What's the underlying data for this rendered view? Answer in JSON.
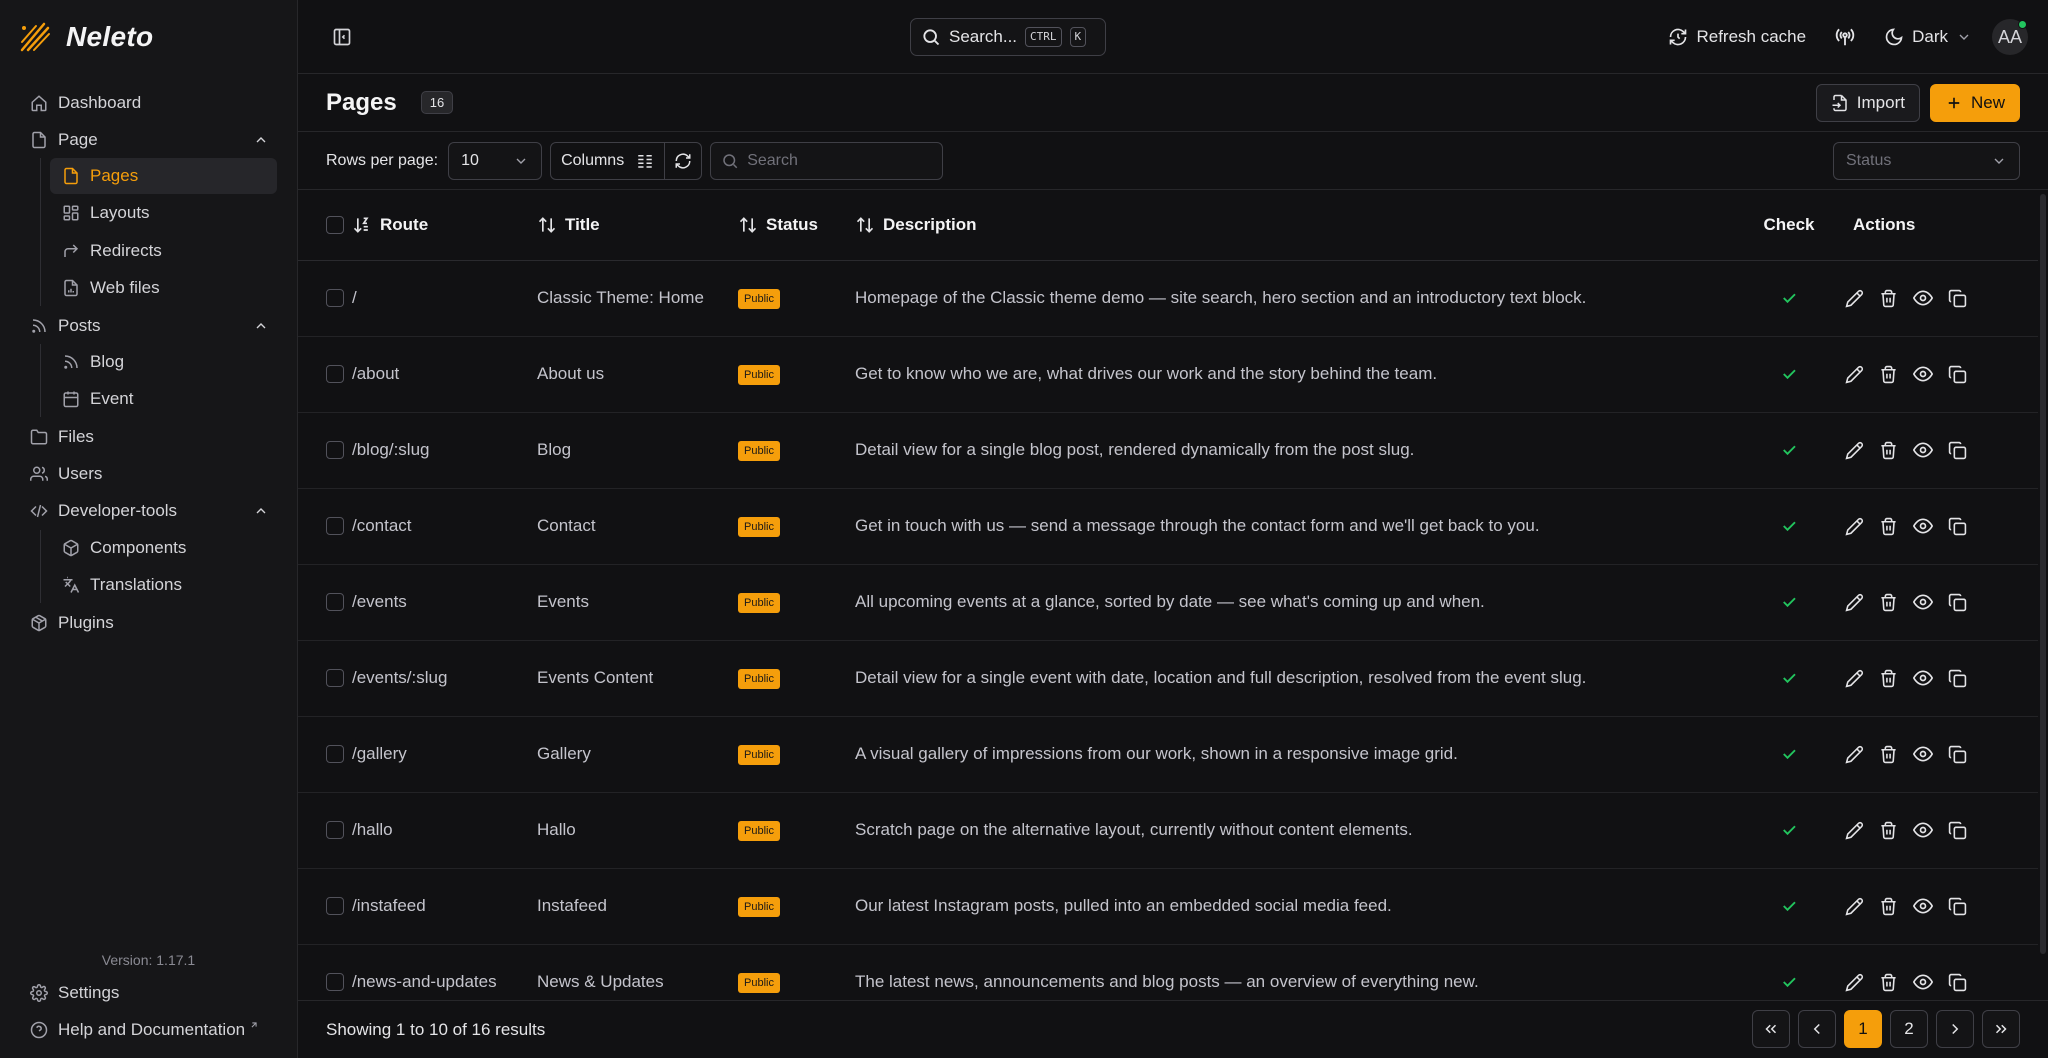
{
  "brand": {
    "name": "Neleto"
  },
  "sidebar": {
    "items": [
      {
        "label": "Dashboard",
        "icon": "home-icon"
      },
      {
        "label": "Page",
        "icon": "file-icon",
        "expanded": true,
        "children": [
          {
            "label": "Pages",
            "icon": "file-icon",
            "active": true
          },
          {
            "label": "Layouts",
            "icon": "layout-icon"
          },
          {
            "label": "Redirects",
            "icon": "redirect-icon"
          },
          {
            "label": "Web files",
            "icon": "web-file-icon"
          }
        ]
      },
      {
        "label": "Posts",
        "icon": "rss-icon",
        "expanded": true,
        "children": [
          {
            "label": "Blog",
            "icon": "rss-icon"
          },
          {
            "label": "Event",
            "icon": "calendar-icon"
          }
        ]
      },
      {
        "label": "Files",
        "icon": "folder-icon"
      },
      {
        "label": "Users",
        "icon": "users-icon"
      },
      {
        "label": "Developer-tools",
        "icon": "code-icon",
        "expanded": true,
        "children": [
          {
            "label": "Components",
            "icon": "box-icon"
          },
          {
            "label": "Translations",
            "icon": "translate-icon"
          }
        ]
      },
      {
        "label": "Plugins",
        "icon": "package-icon"
      }
    ],
    "version": "Version: 1.17.1",
    "settings_label": "Settings",
    "help_label": "Help and Documentation"
  },
  "topbar": {
    "search_label": "Search...",
    "kbd_ctrl": "CTRL",
    "kbd_k": "K",
    "refresh_label": "Refresh cache",
    "theme_label": "Dark",
    "avatar_initials": "AA"
  },
  "page": {
    "title": "Pages",
    "count": "16",
    "import_label": "Import",
    "new_label": "New"
  },
  "toolbar": {
    "rows_label": "Rows per page:",
    "rows_value": "10",
    "columns_label": "Columns",
    "search_placeholder": "Search",
    "status_placeholder": "Status"
  },
  "table": {
    "headers": {
      "route": "Route",
      "title": "Title",
      "status": "Status",
      "description": "Description",
      "check": "Check",
      "actions": "Actions"
    },
    "rows": [
      {
        "route": "/",
        "title": "Classic Theme: Home",
        "status": "Public",
        "description": "Homepage of the Classic theme demo — site search, hero section and an introductory text block."
      },
      {
        "route": "/about",
        "title": "About us",
        "status": "Public",
        "description": "Get to know who we are, what drives our work and the story behind the team."
      },
      {
        "route": "/blog/:slug",
        "title": "Blog",
        "status": "Public",
        "description": "Detail view for a single blog post, rendered dynamically from the post slug."
      },
      {
        "route": "/contact",
        "title": "Contact",
        "status": "Public",
        "description": "Get in touch with us — send a message through the contact form and we'll get back to you."
      },
      {
        "route": "/events",
        "title": "Events",
        "status": "Public",
        "description": "All upcoming events at a glance, sorted by date — see what's coming up and when."
      },
      {
        "route": "/events/:slug",
        "title": "Events Content",
        "status": "Public",
        "description": "Detail view for a single event with date, location and full description, resolved from the event slug."
      },
      {
        "route": "/gallery",
        "title": "Gallery",
        "status": "Public",
        "description": "A visual gallery of impressions from our work, shown in a responsive image grid."
      },
      {
        "route": "/hallo",
        "title": "Hallo",
        "status": "Public",
        "description": "Scratch page on the alternative layout, currently without content elements."
      },
      {
        "route": "/instafeed",
        "title": "Instafeed",
        "status": "Public",
        "description": "Our latest Instagram posts, pulled into an embedded social media feed."
      },
      {
        "route": "/news-and-updates",
        "title": "News & Updates",
        "status": "Public",
        "description": "The latest news, announcements and blog posts — an overview of everything new."
      }
    ]
  },
  "footer": {
    "showing": "Showing 1 to 10 of 16 results",
    "pages": [
      "1",
      "2"
    ],
    "current_page": "1"
  },
  "colors": {
    "accent": "#f59e0b",
    "check": "#22c55e",
    "background": "#111113",
    "online": "#22c55e"
  }
}
